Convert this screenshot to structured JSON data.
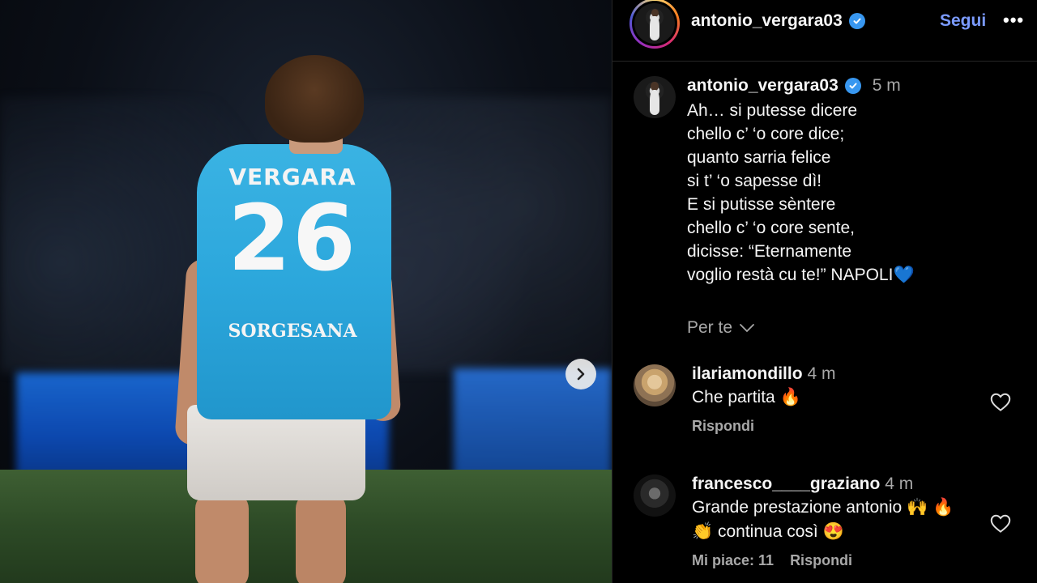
{
  "post": {
    "photo": {
      "jersey_name": "VERGARA",
      "jersey_number": "26",
      "jersey_sponsor": "SORGESANA",
      "next_icon": "chevron-right-icon"
    }
  },
  "header": {
    "username": "antonio_vergara03",
    "follow_label": "Segui",
    "more_label": "•••",
    "verified_icon": "verified-badge-icon"
  },
  "caption": {
    "username": "antonio_vergara03",
    "time": "5 m",
    "lines": [
      "Ah… si putesse dicere",
      "chello c’ ‘o core dice;",
      "quanto sarria felice",
      "si t’ ‘o sapesse dì!",
      "E si putisse sèntere",
      "chello c’ ‘o core sente,",
      "dicisse: “Eternamente",
      "voglio restà cu te!” NAPOLI"
    ],
    "emoji_end": "💙"
  },
  "per_te": {
    "label": "Per te"
  },
  "comments": [
    {
      "username": "ilariamondillo",
      "time": "4 m",
      "text": "Che partita 🔥",
      "reply_label": "Rispondi",
      "likes_label": ""
    },
    {
      "username": "francesco____graziano",
      "time": "4 m",
      "text": "Grande prestazione antonio 🙌 🔥 👏 continua così 😍",
      "reply_label": "Rispondi",
      "likes_label": "Mi piace: 11"
    }
  ],
  "colors": {
    "accent": "#7b9bff",
    "verified": "#3897f0",
    "muted": "#a8a8a8",
    "jersey": "#2ca7dc"
  }
}
